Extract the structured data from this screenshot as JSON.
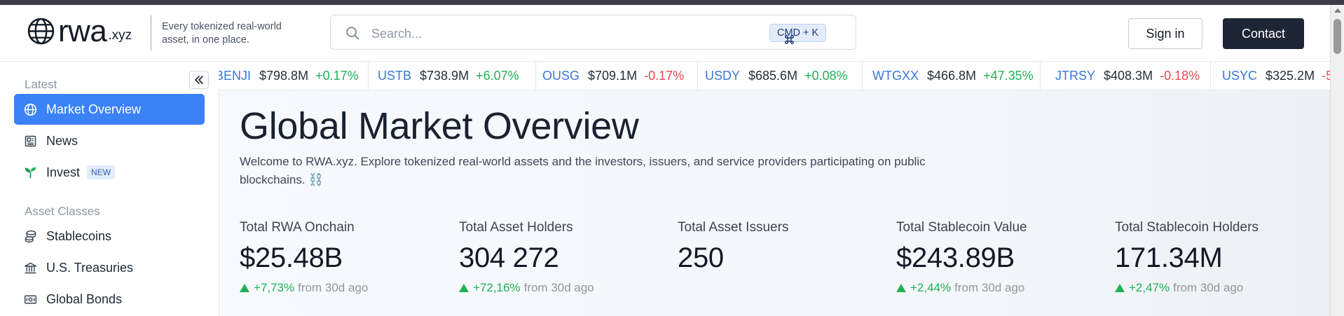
{
  "header": {
    "logo_word": "rwa",
    "logo_tld": ".xyz",
    "tagline": "Every tokenized real-world asset, in one place.",
    "search_placeholder": "Search...",
    "shortcut": "CMD + K",
    "signin_label": "Sign in",
    "contact_label": "Contact"
  },
  "sidebar": {
    "sections": [
      {
        "label": "Latest"
      },
      {
        "label": "Asset Classes"
      }
    ],
    "items": [
      {
        "label": "Market Overview",
        "icon": "globe-icon",
        "active": true
      },
      {
        "label": "News",
        "icon": "newspaper-icon"
      },
      {
        "label": "Invest",
        "icon": "sprout-icon",
        "badge": "NEW"
      },
      {
        "label": "Stablecoins",
        "icon": "coins-icon"
      },
      {
        "label": "U.S. Treasuries",
        "icon": "bank-icon"
      },
      {
        "label": "Global Bonds",
        "icon": "banknote-icon"
      }
    ]
  },
  "ticker": [
    {
      "symbol": "BENJI",
      "value": "$798.8M",
      "change": "+0.17%"
    },
    {
      "symbol": "USTB",
      "value": "$738.9M",
      "change": "+6.07%"
    },
    {
      "symbol": "OUSG",
      "value": "$709.1M",
      "change": "-0.17%"
    },
    {
      "symbol": "USDY",
      "value": "$685.6M",
      "change": "+0.08%"
    },
    {
      "symbol": "WTGXX",
      "value": "$466.8M",
      "change": "+47.35%"
    },
    {
      "symbol": "JTRSY",
      "value": "$408.3M",
      "change": "-0.18%"
    },
    {
      "symbol": "USYC",
      "value": "$325.2M",
      "change": "-5"
    }
  ],
  "main": {
    "title": "Global Market Overview",
    "intro": "Welcome to RWA.xyz. Explore tokenized real-world assets and the investors, issuers, and service providers participating on public blockchains. ⛓️",
    "stats": [
      {
        "label": "Total RWA Onchain",
        "value": "$25.48B",
        "change": "+7,73%",
        "period": "from 30d ago"
      },
      {
        "label": "Total Asset Holders",
        "value": "304 272",
        "change": "+72,16%",
        "period": "from 30d ago"
      },
      {
        "label": "Total Asset Issuers",
        "value": "250"
      },
      {
        "label": "Total Stablecoin Value",
        "value": "$243.89B",
        "change": "+2,44%",
        "period": "from 30d ago"
      },
      {
        "label": "Total Stablecoin Holders",
        "value": "171.34M",
        "change": "+2,47%",
        "period": "from 30d ago"
      }
    ]
  },
  "colors": {
    "accent": "#3b82f6",
    "positive": "#1fb155",
    "negative": "#e5484d",
    "ticker_symbol": "#3a77d8",
    "dark_button": "#1e2636"
  }
}
